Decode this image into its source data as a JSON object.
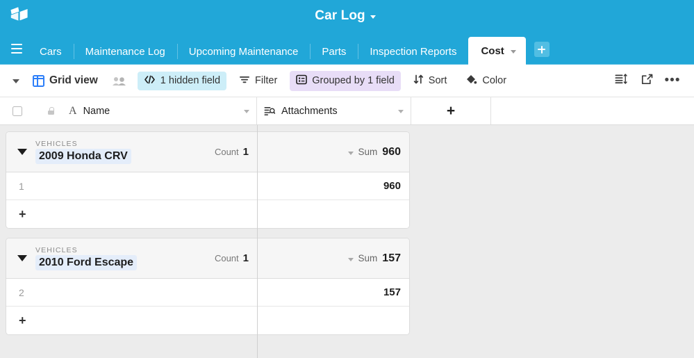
{
  "header": {
    "logo_icon": "airtable-cube-icon",
    "base_title": "Car Log",
    "base_caret_icon": "chevron-down-icon",
    "accent_color": "#21a7d8"
  },
  "tabs": {
    "menu_icon": "hamburger-menu-icon",
    "items": [
      {
        "label": "Cars",
        "active": false
      },
      {
        "label": "Maintenance Log",
        "active": false
      },
      {
        "label": "Upcoming Maintenance",
        "active": false
      },
      {
        "label": "Parts",
        "active": false
      },
      {
        "label": "Inspection Reports",
        "active": false
      },
      {
        "label": "Cost",
        "active": true
      }
    ],
    "add_table_icon": "plus-icon"
  },
  "toolbar": {
    "sidebar_caret_icon": "chevron-down-icon",
    "view_icon": "grid-view-icon",
    "view_name": "Grid view",
    "collaborators_icon": "people-icon",
    "hidden_field": {
      "icon": "hide-fields-icon",
      "label": "1 hidden field",
      "pill_color": "#cdeef8"
    },
    "filter": {
      "icon": "filter-icon",
      "label": "Filter"
    },
    "group": {
      "icon": "group-icon",
      "label": "Grouped by 1 field",
      "pill_color": "#e8ddf7"
    },
    "sort": {
      "icon": "sort-icon",
      "label": "Sort"
    },
    "color": {
      "icon": "color-paint-icon",
      "label": "Color"
    },
    "row_height_icon": "row-height-icon",
    "share_icon": "share-export-icon",
    "more_icon": "more-horizontal-icon"
  },
  "grid": {
    "select_all_icon": "checkbox-icon",
    "primary_lock_icon": "lock-icon",
    "columns": [
      {
        "name": "Name",
        "type_icon": "text-field-icon",
        "menu_icon": "chevron-down-icon"
      },
      {
        "name": "Attachments",
        "type_icon": "lookup-field-icon",
        "menu_icon": "chevron-down-icon"
      }
    ],
    "add_field_label": "+",
    "groups": [
      {
        "group_field": "VEHICLES",
        "group_value": "2009 Honda CRV",
        "collapse_icon": "triangle-down-icon",
        "count_label": "Count",
        "count_value": "1",
        "summary_caret_icon": "chevron-down-icon",
        "summary_label": "Sum",
        "summary_value": "960",
        "rows": [
          {
            "row_number": "1",
            "name": "",
            "attachments": "960"
          }
        ],
        "add_row_label": "+"
      },
      {
        "group_field": "VEHICLES",
        "group_value": "2010 Ford Escape",
        "collapse_icon": "triangle-down-icon",
        "count_label": "Count",
        "count_value": "1",
        "summary_caret_icon": "chevron-down-icon",
        "summary_label": "Sum",
        "summary_value": "157",
        "rows": [
          {
            "row_number": "2",
            "name": "",
            "attachments": "157"
          }
        ],
        "add_row_label": "+"
      }
    ]
  }
}
